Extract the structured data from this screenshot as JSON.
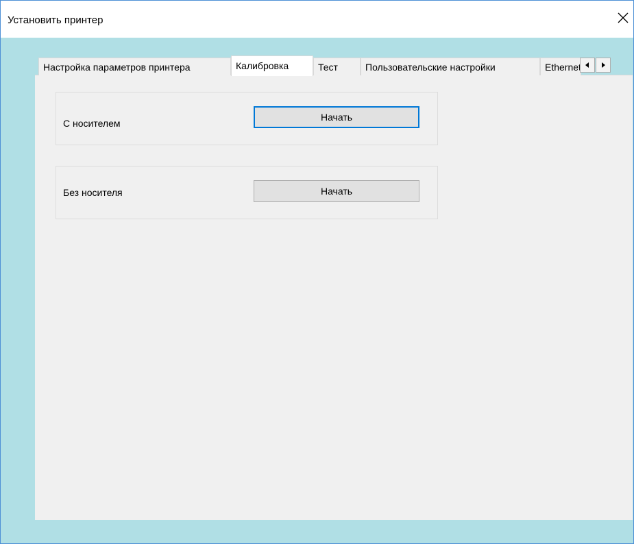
{
  "window": {
    "title": "Установить принтер",
    "close_icon": "close-icon"
  },
  "tabs": [
    {
      "label": "Настройка параметров принтера",
      "active": false
    },
    {
      "label": "Калибровка",
      "active": true
    },
    {
      "label": "Тест",
      "active": false
    },
    {
      "label": "Пользовательские настройки",
      "active": false
    },
    {
      "label": "Ethernet",
      "active": false
    }
  ],
  "tab_scroll": {
    "left_icon": "arrow-left-icon",
    "right_icon": "arrow-right-icon"
  },
  "calibration": {
    "with_media": {
      "label": "С носителем",
      "button": "Начать"
    },
    "without_media": {
      "label": "Без носителя",
      "button": "Начать"
    }
  },
  "colors": {
    "window_frame": "#b0dfe5",
    "client_bg": "#f0f0f0",
    "focus_accent": "#0078d7"
  }
}
